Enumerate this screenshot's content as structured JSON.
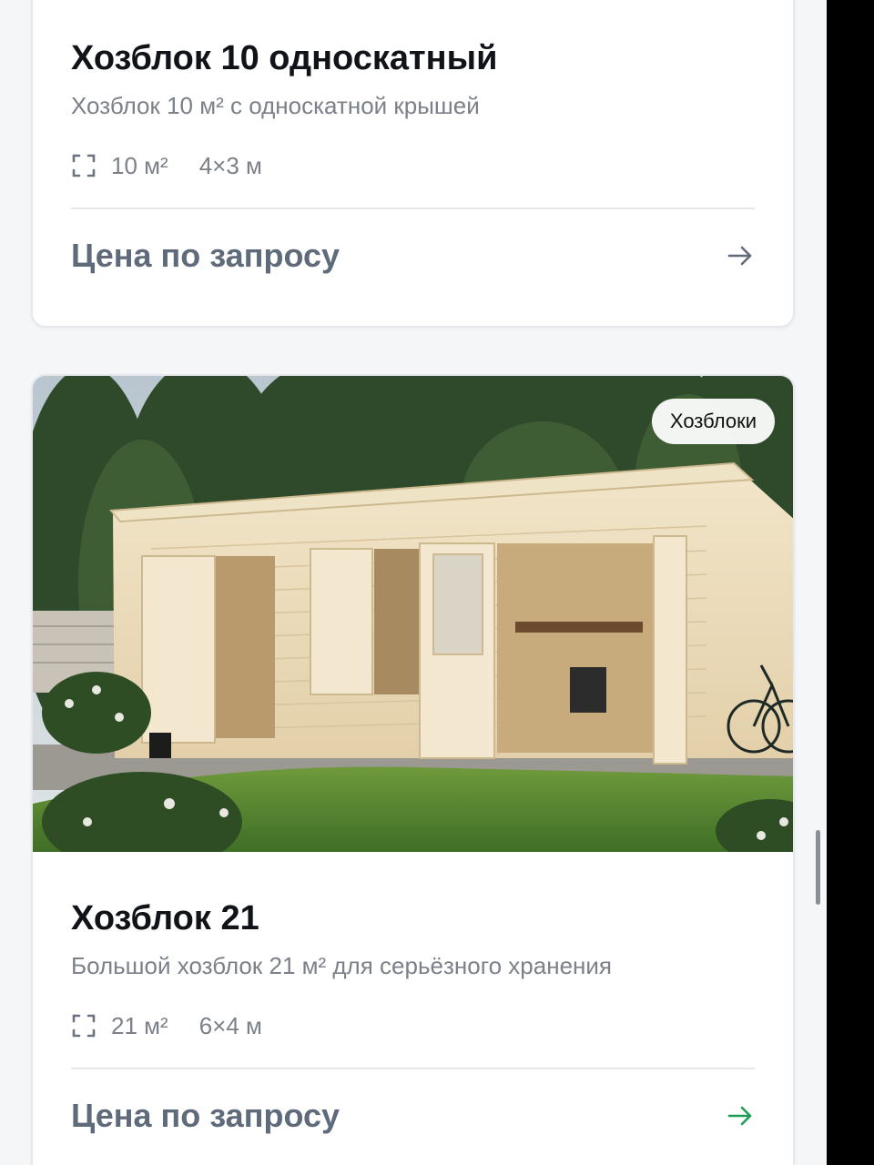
{
  "cards": [
    {
      "title": "Хозблок 10 односкатный",
      "subtitle": "Хозблок 10 м² с односкатной крышей",
      "area": "10 м²",
      "dims": "4×3 м",
      "price": "Цена по запросу",
      "area_icon": "area-frame-icon",
      "arrow_icon": "arrow-right-icon",
      "arrow_color": "#5f6b7a"
    },
    {
      "badge": "Хозблоки",
      "title": "Хозблок 21",
      "subtitle": "Большой хозблок 21 м² для серьёзного хранения",
      "area": "21 м²",
      "dims": "6×4 м",
      "price": "Цена по запросу",
      "area_icon": "area-frame-icon",
      "arrow_icon": "arrow-right-icon",
      "arrow_color": "#1f9d55"
    }
  ],
  "colors": {
    "title": "#101318",
    "muted": "#7b8089",
    "price": "#5f6b7a",
    "accent_green": "#1f9d55"
  }
}
